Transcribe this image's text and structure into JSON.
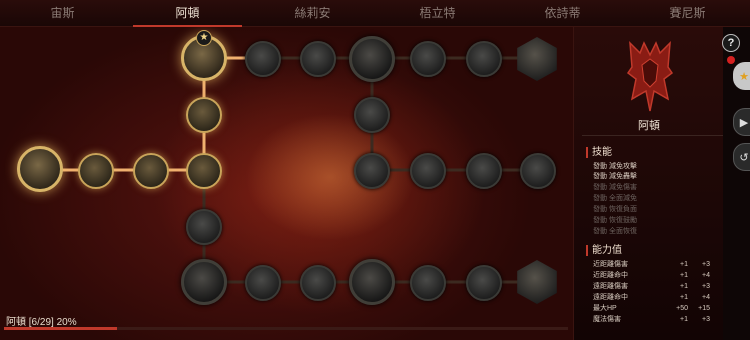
{
  "tabs": [
    "宙斯",
    "阿頓",
    "絲莉安",
    "梧立特",
    "依詩蒂",
    "賽尼斯"
  ],
  "active_tab_index": 1,
  "progress": {
    "label": "阿頓 [6/29] 20%",
    "fraction": 0.2
  },
  "hero": {
    "name": "阿頓"
  },
  "skills": {
    "title": "技能",
    "items": [
      {
        "text": "發動 減免攻擊",
        "active": true
      },
      {
        "text": "發動 減免轟擊",
        "active": true
      },
      {
        "text": "發動 減免傷害",
        "active": false
      },
      {
        "text": "發動 全面減免",
        "active": false
      },
      {
        "text": "發動 恢復負面",
        "active": false
      },
      {
        "text": "發動 恢復鼓勵",
        "active": false
      },
      {
        "text": "發動 全面恢復",
        "active": false
      }
    ]
  },
  "stats": {
    "title": "能力值",
    "rows": [
      {
        "name": "近距離傷害",
        "current": "+1",
        "bonus": "+3"
      },
      {
        "name": "近距離命中",
        "current": "+1",
        "bonus": "+4"
      },
      {
        "name": "遠距離傷害",
        "current": "+1",
        "bonus": "+3"
      },
      {
        "name": "遠距離命中",
        "current": "+1",
        "bonus": "+4"
      },
      {
        "name": "最大HP",
        "current": "+50",
        "bonus": "+15"
      },
      {
        "name": "魔法傷害",
        "current": "+1",
        "bonus": "+3"
      }
    ]
  },
  "colors": {
    "accent": "#c0392b",
    "gold": "#d8b468"
  },
  "icons": {
    "help": "?",
    "star": "★",
    "side_gold": "★",
    "side_play": "▶",
    "side_swap": "↺"
  }
}
